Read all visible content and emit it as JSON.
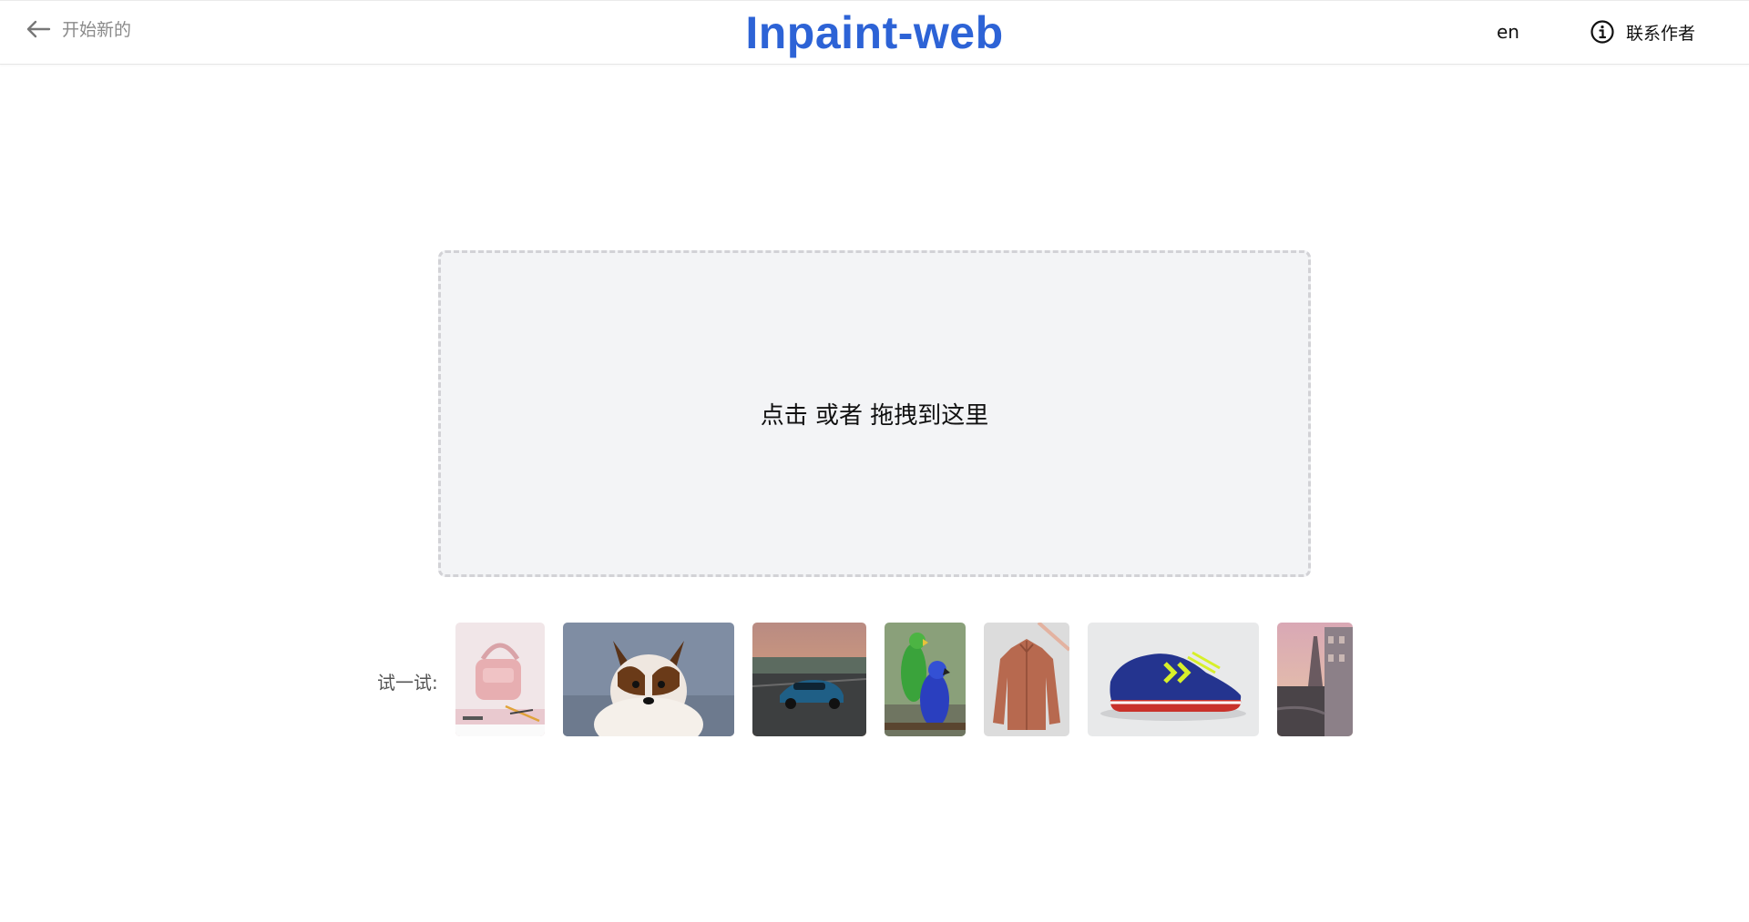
{
  "header": {
    "back_label": "开始新的",
    "title": "Inpaint-web",
    "lang": "en",
    "contact_label": "联系作者"
  },
  "dropzone": {
    "text": "点击 或者 拖拽到这里"
  },
  "examples": {
    "label": "试一试:",
    "items": [
      {
        "name": "handbag"
      },
      {
        "name": "dog"
      },
      {
        "name": "car"
      },
      {
        "name": "parrots"
      },
      {
        "name": "jacket"
      },
      {
        "name": "sneaker"
      },
      {
        "name": "paris-street"
      }
    ]
  },
  "colors": {
    "brand": "#2d63d6",
    "dropzone_bg": "#f3f4f6",
    "dropzone_border": "#d2d2d6"
  }
}
